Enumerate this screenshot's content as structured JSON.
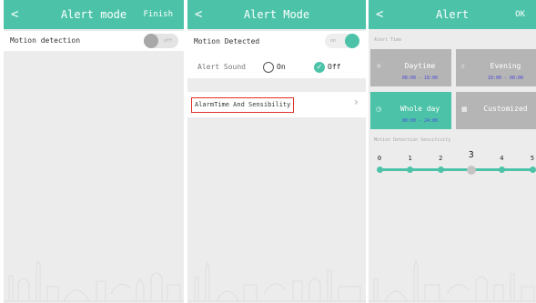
{
  "screen1": {
    "nav": {
      "back_icon": "back-arrow-icon",
      "back_glyph": "<",
      "title": "Alert mode",
      "action": "Finish"
    },
    "motion_detection": {
      "label": "Motion detection",
      "toggle_state": "off",
      "toggle_text": "off"
    }
  },
  "screen2": {
    "nav": {
      "back_icon": "back-arrow-icon",
      "back_glyph": "<",
      "title": "Alert Mode"
    },
    "motion_detected": {
      "label": "Motion Detected",
      "toggle_state": "on",
      "toggle_text": "on"
    },
    "alert_sound": {
      "label": "Alert Sound",
      "options": [
        {
          "label": "On",
          "selected": false
        },
        {
          "label": "Off",
          "selected": true
        }
      ]
    },
    "alarm_time_row": {
      "label": "AlarmTime And Sensibility",
      "chevron": "›",
      "highlight_color": "#e0302a"
    }
  },
  "screen3": {
    "nav": {
      "back_icon": "back-arrow-icon",
      "back_glyph": "<",
      "title": "Alert",
      "action": "OK"
    },
    "alert_time_label": "Alert Time",
    "time_options": [
      {
        "name": "Daytime",
        "range": "08:00 - 18:00",
        "icon": "sun-icon",
        "glyph": "☼",
        "selected": false
      },
      {
        "name": "Evening",
        "range": "18:00 - 08:00",
        "icon": "moon-icon",
        "glyph": "☾",
        "selected": false
      },
      {
        "name": "Whole day",
        "range": "00:00 - 24:00",
        "icon": "clock-icon",
        "glyph": "◷",
        "selected": true
      },
      {
        "name": "Customized",
        "range": "",
        "icon": "calendar-icon",
        "glyph": "▦",
        "selected": false
      }
    ],
    "sensitivity_label": "Motion Detection Sensitivity",
    "sensitivity": {
      "levels": [
        "0",
        "1",
        "2",
        "3",
        "4",
        "5"
      ],
      "selected": "3"
    }
  },
  "colors": {
    "accent": "#4cc3a8",
    "background": "#ececec",
    "tile_unselected": "#b5b5b5",
    "range_text": "#4a4ad8",
    "highlight": "#e0302a"
  }
}
